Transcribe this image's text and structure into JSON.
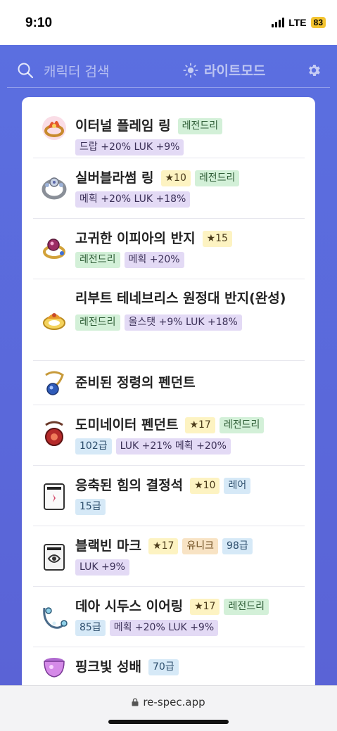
{
  "status_bar": {
    "time": "9:10",
    "network": "LTE",
    "battery": "83"
  },
  "header": {
    "search_placeholder": "캐릭터 검색",
    "mode_label": "라이트모드"
  },
  "items": [
    {
      "name": "이터널 플레임 링",
      "icon": "flame-ring-icon",
      "tags": [
        {
          "text": "레전드리",
          "kind": "legend"
        }
      ],
      "tags2": [
        {
          "text": "드랍 +20% LUK +9%",
          "kind": "stat"
        }
      ]
    },
    {
      "name": "실버블라썸 링",
      "icon": "silver-blossom-ring-icon",
      "tags": [
        {
          "text": "★10",
          "kind": "star"
        },
        {
          "text": "레전드리",
          "kind": "legend"
        }
      ],
      "tags2": [
        {
          "text": "메획 +20% LUK +18%",
          "kind": "stat"
        }
      ]
    },
    {
      "name": "고귀한 이피아의 반지",
      "icon": "iphia-ring-icon",
      "tags": [
        {
          "text": "★15",
          "kind": "star"
        }
      ],
      "tags2": [
        {
          "text": "레전드리",
          "kind": "legend"
        },
        {
          "text": "메획 +20%",
          "kind": "stat"
        }
      ]
    },
    {
      "name": "리부트 테네브리스 원정대 반지(완성)",
      "icon": "tenebris-ring-icon",
      "tags": [],
      "tags2": [
        {
          "text": "레전드리",
          "kind": "legend"
        },
        {
          "text": "올스탯 +9% LUK +18%",
          "kind": "stat"
        }
      ]
    },
    {
      "name": "준비된 정령의 펜던트",
      "icon": "spirit-pendant-icon",
      "tags": [],
      "tags2": []
    },
    {
      "name": "도미네이터 펜던트",
      "icon": "dominator-pendant-icon",
      "tags": [
        {
          "text": "★17",
          "kind": "star"
        },
        {
          "text": "레전드리",
          "kind": "legend"
        }
      ],
      "tags2": [
        {
          "text": "102급",
          "kind": "level"
        },
        {
          "text": "LUK +21% 메획 +20%",
          "kind": "stat"
        }
      ]
    },
    {
      "name": "응축된 힘의 결정석",
      "icon": "crystal-card-icon",
      "tags": [
        {
          "text": "★10",
          "kind": "star"
        },
        {
          "text": "레어",
          "kind": "rare"
        }
      ],
      "tags2": [
        {
          "text": "15급",
          "kind": "level"
        }
      ]
    },
    {
      "name": "블랙빈 마크",
      "icon": "blackbean-mark-icon",
      "tags": [
        {
          "text": "★17",
          "kind": "star"
        },
        {
          "text": "유니크",
          "kind": "unique"
        },
        {
          "text": "98급",
          "kind": "level"
        }
      ],
      "tags2": [
        {
          "text": "LUK +9%",
          "kind": "stat"
        }
      ]
    },
    {
      "name": "데아 시두스 이어링",
      "icon": "dea-sidus-earring-icon",
      "tags": [
        {
          "text": "★17",
          "kind": "star"
        },
        {
          "text": "레전드리",
          "kind": "legend"
        }
      ],
      "tags2": [
        {
          "text": "85급",
          "kind": "level"
        },
        {
          "text": "메획 +20% LUK +9%",
          "kind": "stat"
        }
      ]
    },
    {
      "name": "핑크빛 성배",
      "icon": "pink-holy-cup-icon",
      "tags": [
        {
          "text": "70급",
          "kind": "level"
        }
      ],
      "tags2": []
    }
  ],
  "browser": {
    "url": "re-spec.app"
  },
  "colors": {
    "accent": "#5b6fe0",
    "legend": "#d3f0d8",
    "star": "#fdf3c2",
    "stat": "#e3daf5",
    "level": "#d6e9f7"
  }
}
